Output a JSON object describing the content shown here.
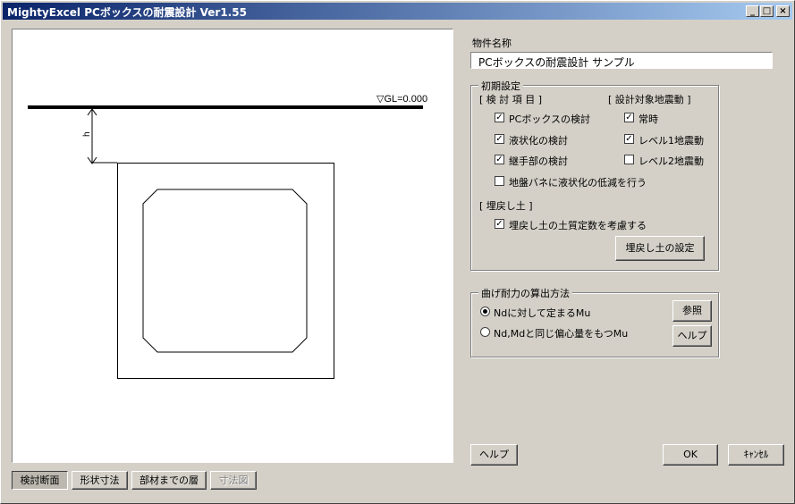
{
  "window": {
    "title": "MightyExcel PCボックスの耐震設計 Ver1.55",
    "min_glyph": "_",
    "max_glyph": "□",
    "close_glyph": "×"
  },
  "drawing": {
    "gl_label": "▽GL=0.000",
    "h_label": "h"
  },
  "property": {
    "label": "物件名称",
    "value": "PCボックスの耐震設計 サンプル"
  },
  "initial": {
    "legend": "初期設定",
    "items_header": "[ 検 討 項 目 ]",
    "seismic_header": "[ 設計対象地震動 ]",
    "items": [
      {
        "label": "PCボックスの検討",
        "checked": true
      },
      {
        "label": "液状化の検討",
        "checked": true
      },
      {
        "label": "継手部の検討",
        "checked": true
      }
    ],
    "seismic": [
      {
        "label": "常時",
        "checked": true
      },
      {
        "label": "レベル1地震動",
        "checked": true
      },
      {
        "label": "レベル2地震動",
        "checked": false
      }
    ],
    "spring_reduction": {
      "label": "地盤バネに液状化の低減を行う",
      "checked": false
    },
    "backfill_header": "[ 埋戻し土 ]",
    "backfill_option": {
      "label": "埋戻し土の土質定数を考慮する",
      "checked": true
    },
    "backfill_button": "埋戻し土の設定"
  },
  "bending": {
    "legend": "曲げ耐力の算出方法",
    "options": [
      {
        "label": "Ndに対して定まるMu",
        "selected": true
      },
      {
        "label": "Nd,Mdと同じ偏心量をもつMu",
        "selected": false
      }
    ],
    "ref_button": "参照",
    "help_button": "ヘルプ"
  },
  "footer": {
    "help": "ヘルプ",
    "ok": "OK",
    "cancel": "ｷｬﾝｾﾙ"
  },
  "tabs": [
    {
      "label": "検討断面",
      "state": "pressed"
    },
    {
      "label": "形状寸法",
      "state": "normal"
    },
    {
      "label": "部材までの層",
      "state": "normal"
    },
    {
      "label": "寸法図",
      "state": "disabled"
    }
  ],
  "check_glyph": "✓"
}
